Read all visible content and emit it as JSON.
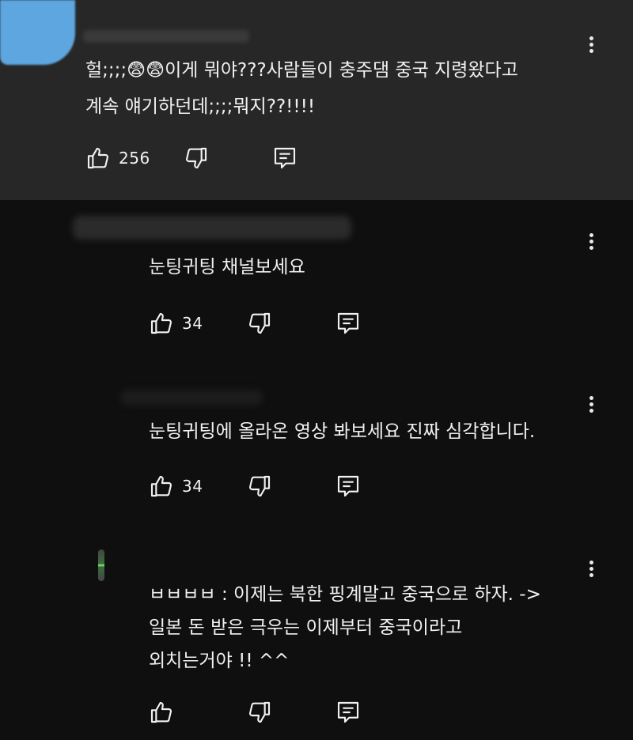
{
  "comments": [
    {
      "text": "헐;;;;😨😨이게 뭐야???사람들이 충주댐 중국 지령왔다고\n계속 얘기하던데;;;;뭐지??!!!!",
      "likes": "256"
    },
    {
      "text": "눈팅귀팅 채널보세요",
      "likes": "34"
    },
    {
      "text": "눈팅귀팅에 올라온 영상 봐보세요 진짜 심각합니다.",
      "likes": "34"
    },
    {
      "text": "ㅂㅂㅂㅂ : 이제는 북한 핑계말고 중국으로 하자. ->\n일본 돈 받은 극우는 이제부터 중국이라고\n외치는거야 !! ^^",
      "likes": ""
    }
  ],
  "icons": {
    "like": "thumbs-up-icon",
    "dislike": "thumbs-down-icon",
    "reply": "reply-comment-icon",
    "more": "more-vert-icon"
  },
  "colors": {
    "highlighted_bg": "#272727",
    "page_bg": "#0f0f0f",
    "text": "#f1f1f1",
    "redaction_blue": "#5ea6e0"
  }
}
